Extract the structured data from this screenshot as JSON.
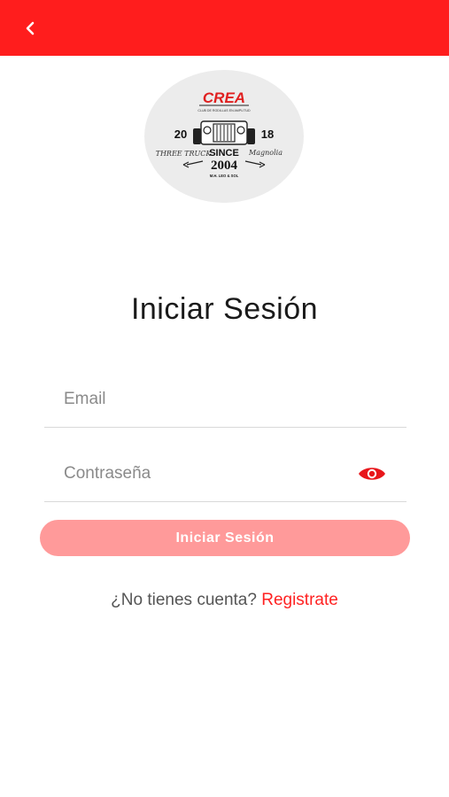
{
  "header": {
    "back_icon": "chevron-left-icon",
    "bar_color": "#ff1d1d"
  },
  "logo": {
    "brand": "CREA",
    "tagline": "CLUB DE RODILLAS EN AMPLITUD",
    "year_left": "20",
    "year_right": "18",
    "since_label": "SINCE",
    "since_year": "2004",
    "left_script": "THREE TRUCK",
    "right_script": "Magnolia",
    "footer": "M.H. LEO & SOL"
  },
  "form": {
    "title": "Iniciar Sesión",
    "email_placeholder": "Email",
    "password_placeholder": "Contraseña",
    "eye_icon": "eye-icon",
    "submit_label": "Iniciar Sesión"
  },
  "signup": {
    "prompt": "¿No tienes cuenta?",
    "link": "Registrate"
  },
  "colors": {
    "accent": "#ff1d1d",
    "button_disabled": "#ff9a9a",
    "link": "#ff2222"
  }
}
